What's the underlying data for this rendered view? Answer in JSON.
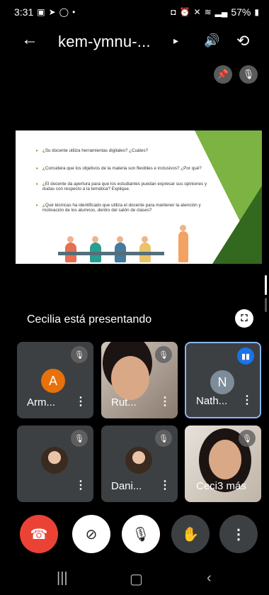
{
  "status": {
    "time": "3:31",
    "battery": "57%"
  },
  "header": {
    "title": "kem-ymnu-...",
    "back_icon": "arrow-back-icon",
    "speaker_icon": "speaker-icon",
    "switch_camera_icon": "switch-camera-icon"
  },
  "presentation": {
    "label": "Cecilia está presentando",
    "slide": {
      "questions": [
        "¿Su docente utiliza herramientas digitales? ¿Cuáles?",
        "¿Considera que los objetivos de la materia son flexibles e inclusivos? ¿Por qué?",
        "¿El docente da apertura para que los estudiantes puedan expresar sus opiniones y dudas con respecto a la temática? Explique.",
        "¿Qué técnicas ha identificado que utiliza el docente para mantener la atención y motivación de los alumnos, dentro del salón de clases?"
      ]
    }
  },
  "participants": [
    {
      "name": "Arm...",
      "avatar_letter": "A",
      "avatar_color": "#e8710a",
      "muted": true
    },
    {
      "name": "Rut...",
      "video": true,
      "muted": true
    },
    {
      "name": "Nath...",
      "avatar_letter": "N",
      "avatar_color": "#7e8c99",
      "speaking": true
    },
    {
      "name": "",
      "photo": true,
      "muted": true
    },
    {
      "name": "Dani...",
      "photo": true,
      "muted": true
    },
    {
      "name": "Ceci",
      "video": true,
      "muted": true,
      "overflow_label": "3 más"
    }
  ],
  "controls": {
    "end_call_icon": "end-call-icon",
    "camera_icon": "camera-off-icon",
    "mic_icon": "mic-off-icon",
    "hand_icon": "raise-hand-icon",
    "more_icon": "more-vert-icon"
  },
  "colors": {
    "end_call": "#ea4335",
    "tile_bg": "#3c4043",
    "active_border": "#8ab4f8",
    "speaking": "#1a73e8"
  }
}
